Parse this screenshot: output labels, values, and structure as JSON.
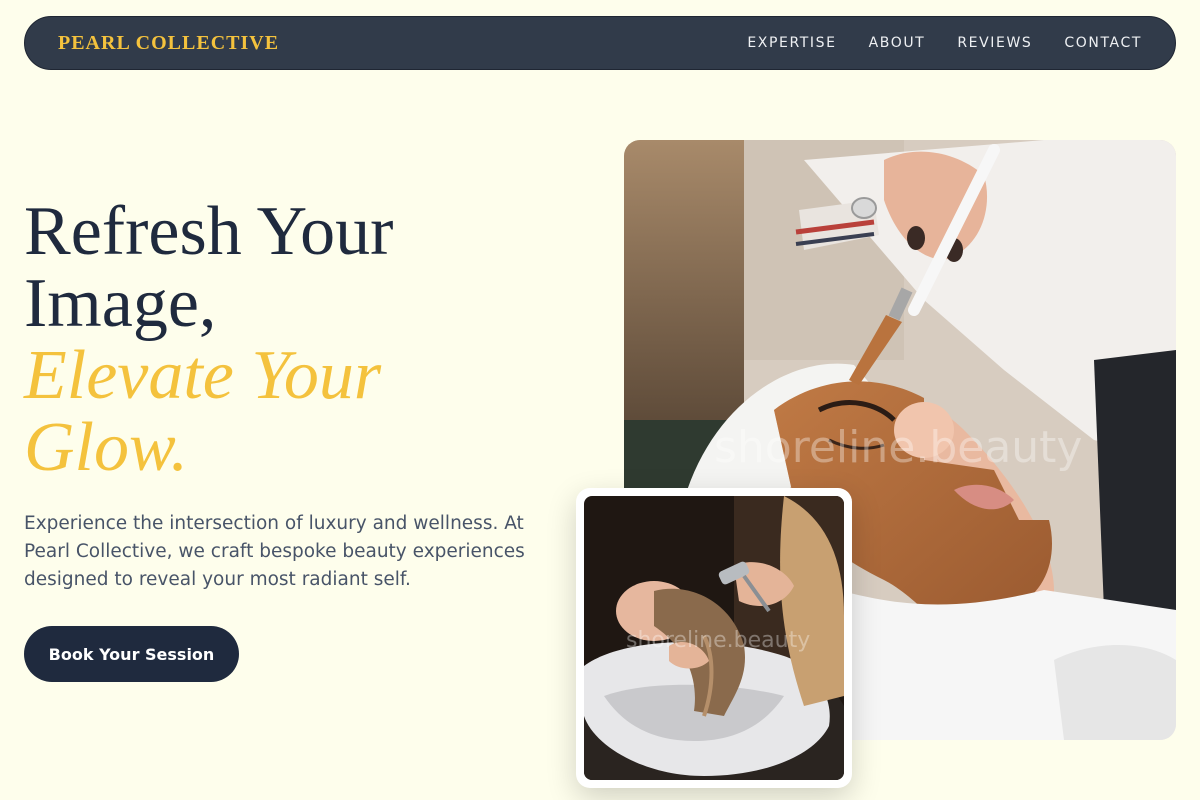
{
  "brand": {
    "name": "PEARL COLLECTIVE"
  },
  "nav": {
    "items": [
      {
        "label": "EXPERTISE"
      },
      {
        "label": "ABOUT"
      },
      {
        "label": "REVIEWS"
      },
      {
        "label": "CONTACT"
      }
    ]
  },
  "hero": {
    "title_line1": "Refresh Your",
    "title_line2": "Image,",
    "title_accent_line1": "Elevate Your",
    "title_accent_line2": "Glow.",
    "description": "Experience the intersection of luxury and wellness. At Pearl Collective, we craft bespoke beauty experiences designed to reveal your most radiant self.",
    "cta_label": "Book Your Session"
  },
  "images": {
    "main_watermark": "shoreline.beauty",
    "secondary_watermark": "shoreline.beauty"
  },
  "colors": {
    "background": "#fefeec",
    "nav_background": "#313b4a",
    "accent": "#f4c23d",
    "primary_dark": "#1f2a3e"
  }
}
